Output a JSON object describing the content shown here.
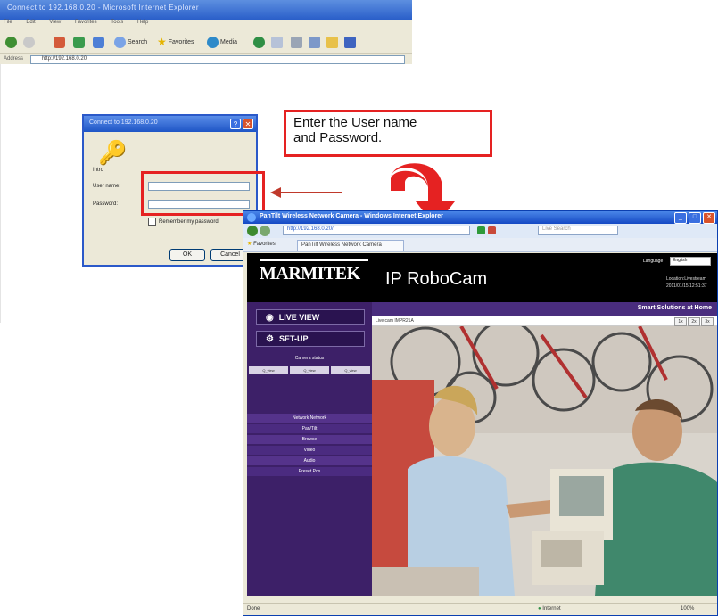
{
  "bg_window": {
    "title": "Connect to 192.168.0.20 - Microsoft Internet Explorer",
    "menu": [
      "File",
      "Edit",
      "View",
      "Favorites",
      "Tools",
      "Help"
    ],
    "toolbar": [
      "Back",
      "Search",
      "Favorites",
      "Media"
    ],
    "address_label": "Address",
    "address": "http://192.168.0.20"
  },
  "login": {
    "title": "Connect to 192.168.0.20",
    "site_label": "Intro",
    "username_label": "User name:",
    "username_value": "",
    "password_label": "Password:",
    "remember_label": "Remember my password",
    "ok": "OK",
    "cancel": "Cancel"
  },
  "callout": {
    "line1": "Enter the User name",
    "line2": "and Password."
  },
  "fg_window": {
    "title": "PanTilt Wireless Network Camera - Windows Internet Explorer",
    "url": "http://192.168.0.20/",
    "search_placeholder": "Live Search",
    "favorites": "Favorites",
    "tab": "PanTilt Wireless Network Camera",
    "status_left": "Done",
    "status_zone": "Internet",
    "status_zoom": "100%"
  },
  "page": {
    "logo": "MARMITEK",
    "product": "IP RoboCam",
    "language_label": "Language",
    "language_value": "English",
    "location_label": "Location:Livestream",
    "datetime": "2011/01/15 12:51:37",
    "slogan": "Smart Solutions at Home",
    "live_view": "LIVE VIEW",
    "setup": "SET-UP",
    "camera_heading": "Camera status",
    "camera_buttons": [
      "Q_view",
      "Q_view",
      "Q_view"
    ],
    "camera_name": "Live:cam IMPR21A",
    "zoom_buttons": [
      "1x",
      "2x",
      "3x"
    ],
    "menu": [
      "Network Network",
      "Pan/Tilt",
      "Browse",
      "Video",
      "Audio",
      "Preset Pos"
    ]
  },
  "colors": {
    "callout_border": "#e52222",
    "sidebar": "#3d2068",
    "header": "#000000"
  }
}
